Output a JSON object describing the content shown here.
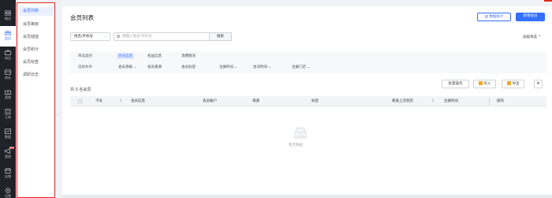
{
  "nav": {
    "items": [
      {
        "label": "概况",
        "icon": "grid-icon"
      },
      {
        "label": "会员",
        "icon": "crown-icon"
      },
      {
        "label": "商品",
        "icon": "bag-icon"
      },
      {
        "label": "库存",
        "icon": "box-icon"
      },
      {
        "label": "营销",
        "icon": "gift-icon"
      },
      {
        "label": "订单",
        "icon": "doc-icon"
      },
      {
        "label": "数据",
        "icon": "chart-icon"
      },
      {
        "label": "营销",
        "icon": "megaphone-icon",
        "badge": "NEW"
      },
      {
        "label": "店铺",
        "icon": "store-icon"
      },
      {
        "label": "设置",
        "icon": "gear-icon"
      }
    ]
  },
  "submenu": {
    "items": [
      {
        "label": "会员列表"
      },
      {
        "label": "会员等级"
      },
      {
        "label": "会员储值"
      },
      {
        "label": "会员积分"
      },
      {
        "label": "会员标签"
      },
      {
        "label": "调研日志"
      }
    ]
  },
  "page": {
    "title": "会员列表",
    "btn_stats": "数据统计",
    "btn_new": "新增会员",
    "select_value": "姓名/手机号",
    "search_placeholder": "请输入姓名/手机号",
    "search_btn": "搜索",
    "advanced": "高级筛选 ^"
  },
  "filter": {
    "row1_label": "筛选类别",
    "tabs": [
      "会员信息",
      "权益信息",
      "消费情况"
    ],
    "row2_label": "选择条件",
    "options": [
      "会员等级 ⌄",
      "会员来源",
      "会员标签",
      "注册时间 ⌄",
      "生日时间 ⌄",
      "注册门店 ⌄"
    ]
  },
  "list": {
    "count": "共 0 名会员",
    "btn_batch": "批量操作",
    "btn_import": "导入",
    "btn_export": "导出",
    "columns": [
      "卡号",
      "会员信息",
      "会员账户",
      "来源",
      "标签",
      "距离上次到店",
      "注册时间",
      "操作"
    ],
    "empty_text": "暂无数据"
  },
  "colors": {
    "accent": "#3370ff",
    "nav_bg": "#1f2329",
    "highlight": "#e0281f"
  }
}
